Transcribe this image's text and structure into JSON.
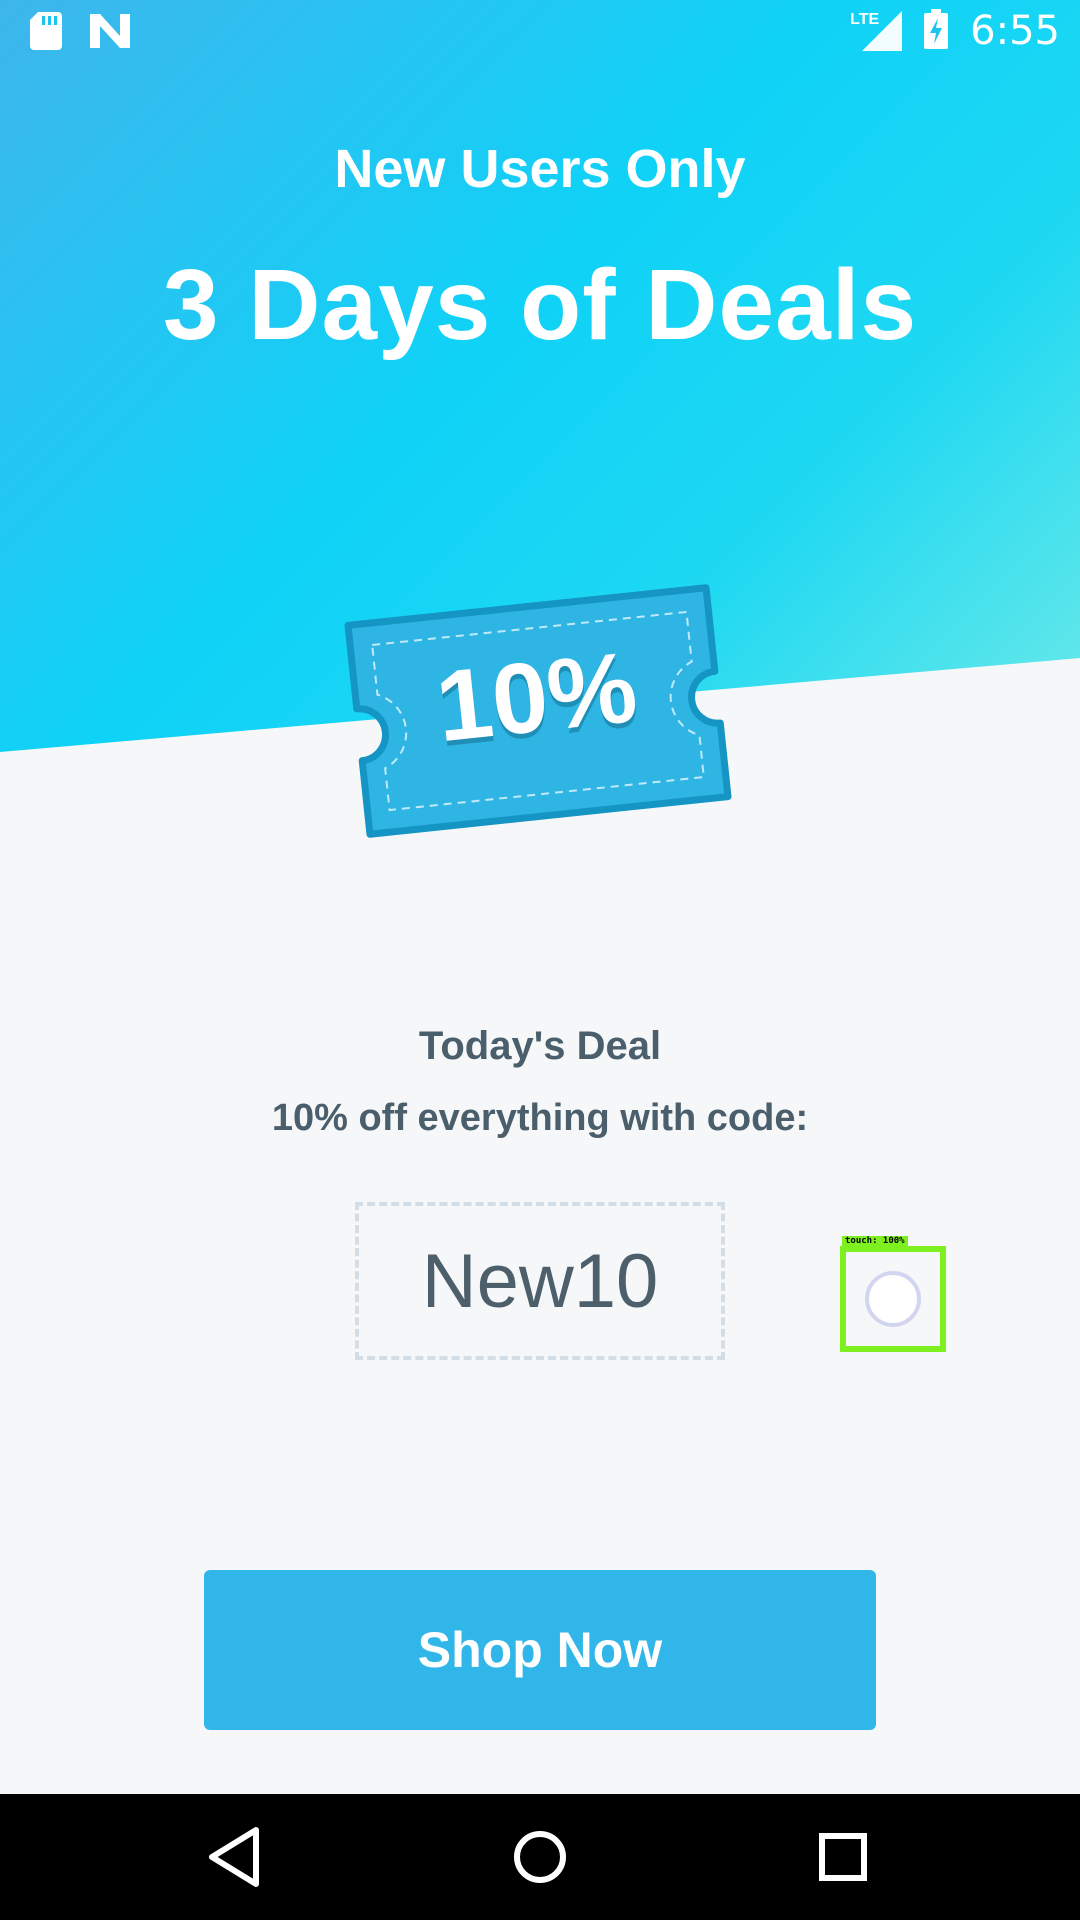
{
  "status_bar": {
    "icons": [
      "sd-card-icon",
      "n-logo-icon",
      "lte-signal-icon",
      "battery-charging-icon"
    ],
    "network_label": "LTE",
    "time": "6:55"
  },
  "hero": {
    "subtitle": "New Users Only",
    "title": "3 Days of Deals",
    "ticket_text": "10%"
  },
  "deal": {
    "label": "Today's Deal",
    "description": "10% off everything with code:",
    "code": "New10"
  },
  "touch_indicator": "touch: 100%",
  "cta": {
    "label": "Shop Now"
  },
  "nav": {
    "icons": [
      "back-icon",
      "home-icon",
      "recents-icon"
    ]
  },
  "colors": {
    "accent": "#31b6ea",
    "text": "#4a5e6c",
    "hero_start": "#3eb6ec",
    "hero_end": "#6deae8",
    "touch_highlight": "#7ef01f"
  }
}
